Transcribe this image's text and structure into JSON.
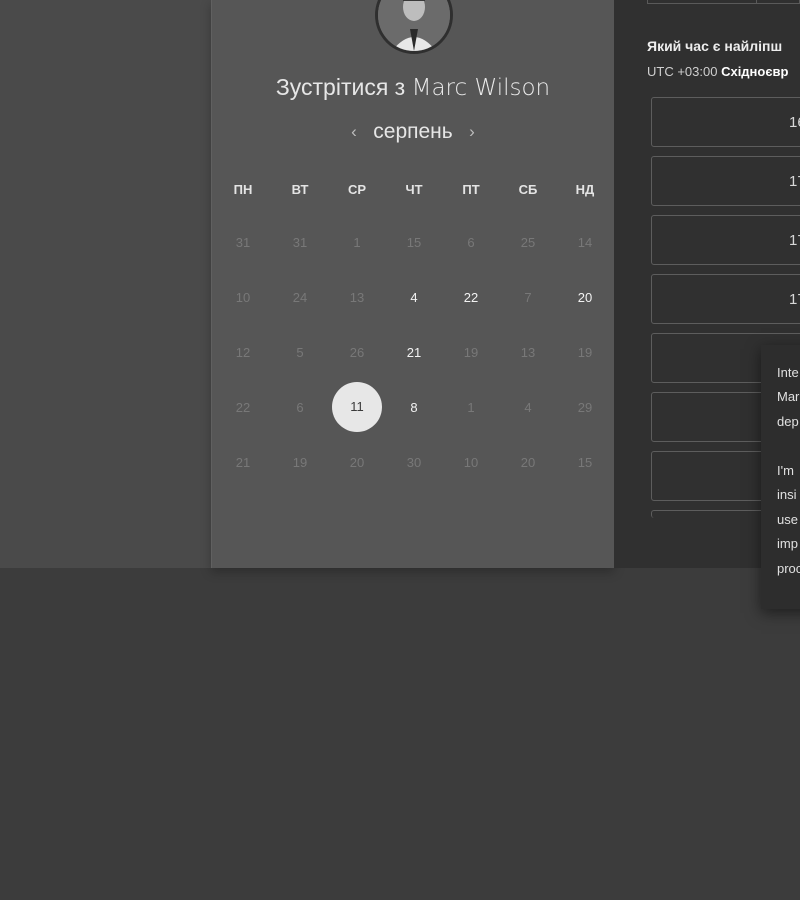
{
  "header": {
    "title_prefix": "Зустрітися з",
    "host_name": "Marc Wilson"
  },
  "calendar": {
    "month": "серпень",
    "prev_icon": "chevron-left-icon",
    "next_icon": "chevron-right-icon",
    "weekdays": [
      "ПН",
      "ВТ",
      "СР",
      "ЧТ",
      "ПТ",
      "СБ",
      "НД"
    ],
    "weeks": [
      [
        {
          "d": "31",
          "a": false
        },
        {
          "d": "31",
          "a": false
        },
        {
          "d": "1",
          "a": false
        },
        {
          "d": "15",
          "a": false
        },
        {
          "d": "6",
          "a": false
        },
        {
          "d": "25",
          "a": false
        },
        {
          "d": "14",
          "a": false
        }
      ],
      [
        {
          "d": "10",
          "a": false
        },
        {
          "d": "24",
          "a": false
        },
        {
          "d": "13",
          "a": false
        },
        {
          "d": "4",
          "a": true
        },
        {
          "d": "22",
          "a": true
        },
        {
          "d": "7",
          "a": false
        },
        {
          "d": "20",
          "a": true
        }
      ],
      [
        {
          "d": "12",
          "a": false
        },
        {
          "d": "5",
          "a": false
        },
        {
          "d": "26",
          "a": false
        },
        {
          "d": "21",
          "a": true
        },
        {
          "d": "19",
          "a": false
        },
        {
          "d": "13",
          "a": false
        },
        {
          "d": "19",
          "a": false
        }
      ],
      [
        {
          "d": "22",
          "a": false
        },
        {
          "d": "6",
          "a": false
        },
        {
          "d": "11",
          "a": true,
          "selected": true
        },
        {
          "d": "8",
          "a": true
        },
        {
          "d": "1",
          "a": false
        },
        {
          "d": "4",
          "a": false
        },
        {
          "d": "29",
          "a": false
        }
      ],
      [
        {
          "d": "21",
          "a": false
        },
        {
          "d": "19",
          "a": false
        },
        {
          "d": "20",
          "a": false
        },
        {
          "d": "30",
          "a": false
        },
        {
          "d": "10",
          "a": false
        },
        {
          "d": "20",
          "a": false
        },
        {
          "d": "15",
          "a": false
        }
      ]
    ]
  },
  "time_panel": {
    "question": "Який час є найліпш",
    "tz_prefix": "UTC +03:00",
    "tz_name": "Східноєвр",
    "slots": [
      "16",
      "17",
      "17",
      "17",
      "",
      "",
      ""
    ]
  },
  "popup": {
    "lines": [
      "Inte",
      "Mar",
      "dep",
      "",
      "I'm",
      "insi",
      "use",
      "imp",
      "proc"
    ]
  }
}
